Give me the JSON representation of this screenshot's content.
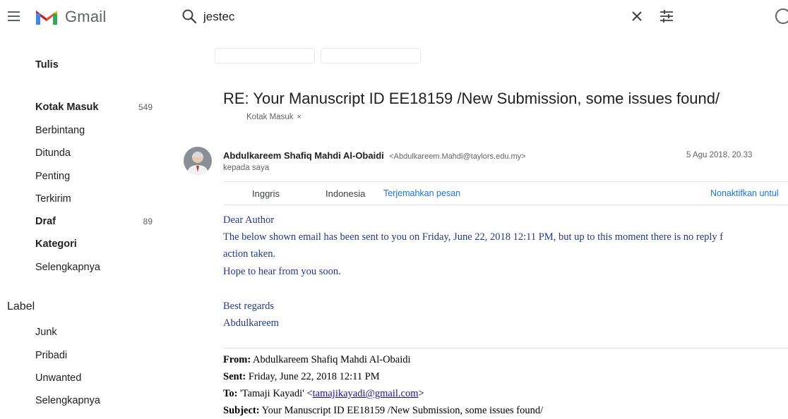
{
  "header": {
    "app_name": "Gmail",
    "search_value": "jestec"
  },
  "sidebar": {
    "compose_label": "Tulis",
    "items": [
      {
        "label": "Kotak Masuk",
        "count": "549"
      },
      {
        "label": "Berbintang",
        "count": ""
      },
      {
        "label": "Ditunda",
        "count": ""
      },
      {
        "label": "Penting",
        "count": ""
      },
      {
        "label": "Terkirim",
        "count": ""
      },
      {
        "label": "Draf",
        "count": "89"
      },
      {
        "label": "Kategori",
        "count": ""
      },
      {
        "label": "Selengkapnya",
        "count": ""
      }
    ],
    "label_header": "Label",
    "labels": [
      "Junk",
      "Pribadi",
      "Unwanted",
      "Selengkapnya"
    ]
  },
  "email": {
    "subject": "RE: Your Manuscript ID EE18159 /New Submission, some issues found/",
    "chip_label": "Kotak Masuk",
    "chip_close": "×",
    "sender_name": "Abdulkareem Shafiq Mahdi Al-Obaidi",
    "sender_email": "<Abdulkareem.Mahdi@taylors.edu.my>",
    "date": "5 Agu 2018, 20.33",
    "recipient": "kepada saya",
    "translate": {
      "lang_from": "Inggris",
      "lang_to": "Indonesia",
      "translate_link": "Terjemahkan pesan",
      "disable_link": "Nonaktifkan untul"
    },
    "body": {
      "greeting": "Dear Author",
      "line1": "The below shown email has been sent to you on Friday, June 22, 2018 12:11 PM, but up to this moment there is no reply f",
      "line2": "action taken.",
      "line3": "Hope to hear from you soon.",
      "regards": "Best regards",
      "signature": "Abdulkareem"
    },
    "quoted": {
      "from_label": "From:",
      "from_value": "Abdulkareem Shafiq Mahdi Al-Obaidi",
      "sent_label": "Sent:",
      "sent_value": "Friday, June 22, 2018 12:11 PM",
      "to_label": "To:",
      "to_name": "'Tamaji Kayadi' <",
      "to_email": "tamajikayadi@gmail.com",
      "to_end": ">",
      "subject_label": "Subject:",
      "subject_value": "Your Manuscript ID EE18159 /New Submission, some issues found/"
    }
  },
  "colors": {
    "brand_red": "#EA4335",
    "link_blue": "#1a73e8",
    "body_text_navy": "#1f3a86"
  },
  "icons": [
    "menu-icon",
    "gmail-logo",
    "search-icon",
    "clear-icon",
    "filter-icon",
    "help-icon"
  ]
}
